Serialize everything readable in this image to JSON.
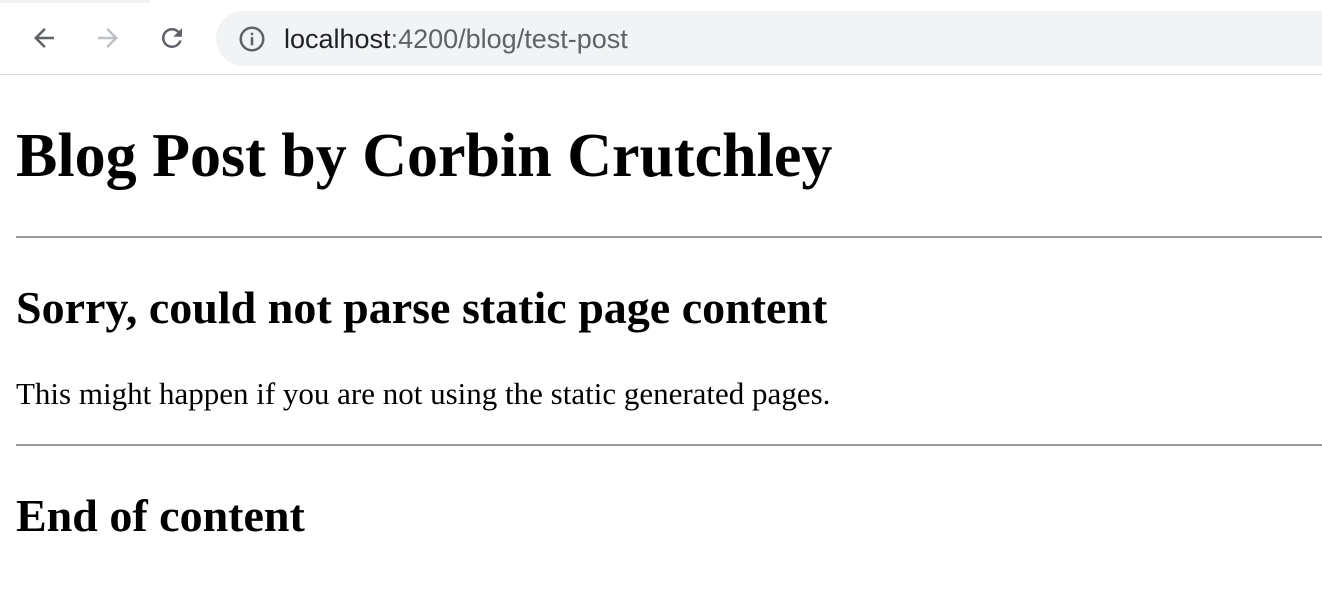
{
  "browser": {
    "address_bar": {
      "url_host": "localhost",
      "url_rest": ":4200/blog/test-post"
    },
    "icons": {
      "back": "arrow-left-icon",
      "forward": "arrow-right-icon",
      "reload": "reload-icon",
      "site_info": "info-icon"
    }
  },
  "page": {
    "title": "Blog Post by Corbin Crutchley",
    "error_heading": "Sorry, could not parse static page content",
    "error_message": "This might happen if you are not using the static generated pages.",
    "end_heading": "End of content"
  },
  "colors": {
    "toolbar_bg": "#ffffff",
    "omnibox_bg": "#f1f3f4",
    "icon_active": "#5f6368",
    "icon_disabled": "#bdc1c6",
    "text": "#000000",
    "rule": "#9a9a9a"
  }
}
